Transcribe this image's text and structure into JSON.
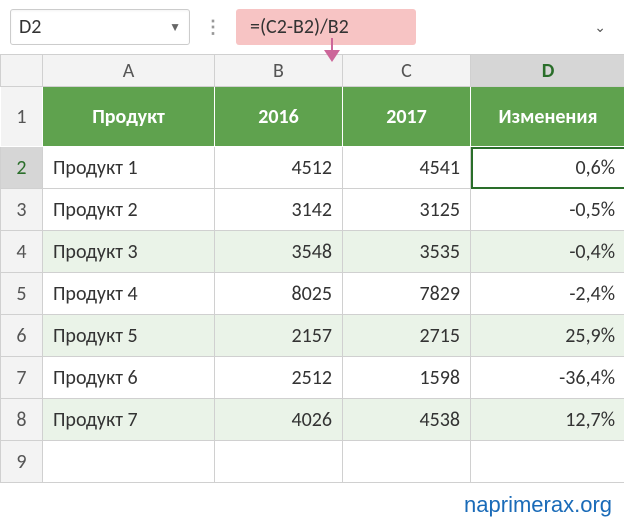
{
  "cell_ref": "D2",
  "formula": "=(C2-B2)/B2",
  "col_headers": [
    "A",
    "B",
    "C",
    "D"
  ],
  "row_headers": [
    "1",
    "2",
    "3",
    "4",
    "5",
    "6",
    "7",
    "8",
    "9"
  ],
  "table_headers": [
    "Продукт",
    "2016",
    "2017",
    "Изменения"
  ],
  "rows": [
    {
      "product": "Продукт 1",
      "y2016": "4512",
      "y2017": "4541",
      "change": "0,6%"
    },
    {
      "product": "Продукт 2",
      "y2016": "3142",
      "y2017": "3125",
      "change": "-0,5%"
    },
    {
      "product": "Продукт 3",
      "y2016": "3548",
      "y2017": "3535",
      "change": "-0,4%"
    },
    {
      "product": "Продукт 4",
      "y2016": "8025",
      "y2017": "7829",
      "change": "-2,4%"
    },
    {
      "product": "Продукт 5",
      "y2016": "2157",
      "y2017": "2715",
      "change": "25,9%"
    },
    {
      "product": "Продукт 6",
      "y2016": "2512",
      "y2017": "1598",
      "change": "-36,4%"
    },
    {
      "product": "Продукт 7",
      "y2016": "4026",
      "y2017": "4538",
      "change": "12,7%"
    }
  ],
  "watermark": "naprimerax.org"
}
